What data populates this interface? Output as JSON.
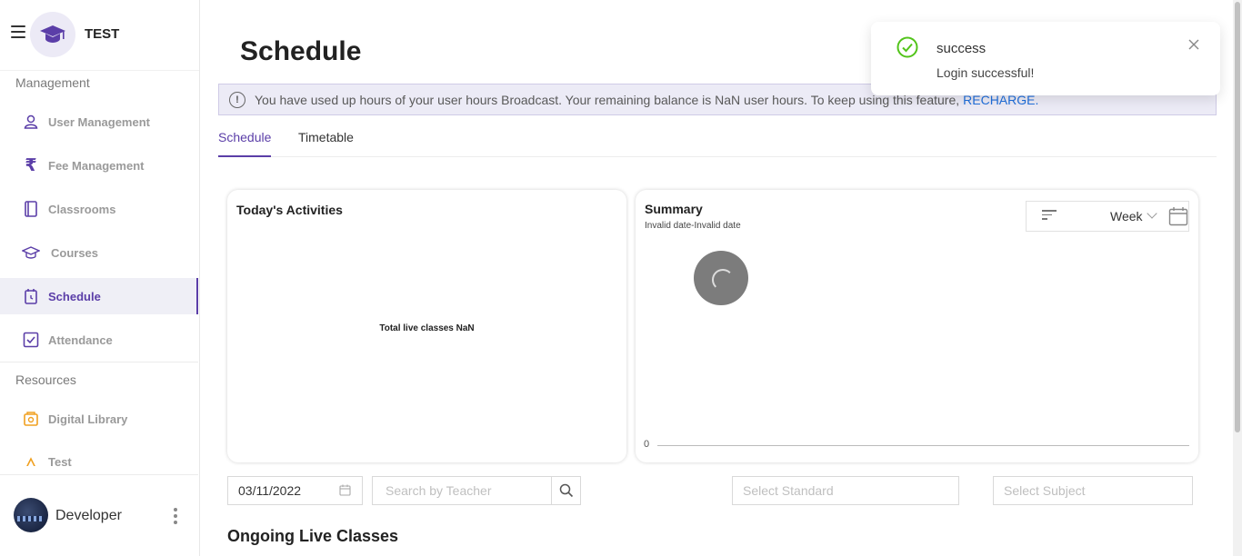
{
  "brand": {
    "name": "TEST",
    "logo_icon": "graduation-cap-icon"
  },
  "sidebar": {
    "sections": [
      {
        "title": "Management"
      },
      {
        "title": "Resources"
      }
    ],
    "items": [
      {
        "label": "User Management",
        "icon": "user-icon"
      },
      {
        "label": "Fee Management",
        "icon": "rupee-icon"
      },
      {
        "label": "Classrooms",
        "icon": "book-icon"
      },
      {
        "label": "Courses",
        "icon": "graduation-cap-icon"
      },
      {
        "label": "Schedule",
        "icon": "calendar-clock-icon",
        "active": true
      },
      {
        "label": "Attendance",
        "icon": "check-square-icon"
      },
      {
        "label": "Digital Library",
        "icon": "library-icon"
      },
      {
        "label": "Test",
        "icon": "test-icon"
      }
    ],
    "user": {
      "name": "Developer"
    }
  },
  "page": {
    "title": "Schedule"
  },
  "alert": {
    "message": "You have used up hours of your user hours Broadcast. Your remaining balance is NaN user hours. To keep using this feature,",
    "link": "RECHARGE."
  },
  "tabs": [
    {
      "label": "Schedule",
      "active": true
    },
    {
      "label": "Timetable",
      "active": false
    }
  ],
  "activities": {
    "title": "Today's Activities",
    "total_text": "Total live classes NaN"
  },
  "summary": {
    "title": "Summary",
    "date_range": "Invalid date-Invalid date",
    "period": "Week",
    "axis_zero": "0"
  },
  "filters": {
    "date_value": "03/11/2022",
    "teacher_placeholder": "Search by Teacher",
    "standard_placeholder": "Select Standard",
    "subject_placeholder": "Select Subject"
  },
  "ongoing_title": "Ongoing Live Classes",
  "toast": {
    "title": "success",
    "message": "Login successful!"
  },
  "colors": {
    "accent": "#5b3ea8",
    "link": "#1f6fdc",
    "success": "#52c41a",
    "alert_bg": "#ecebf6"
  }
}
